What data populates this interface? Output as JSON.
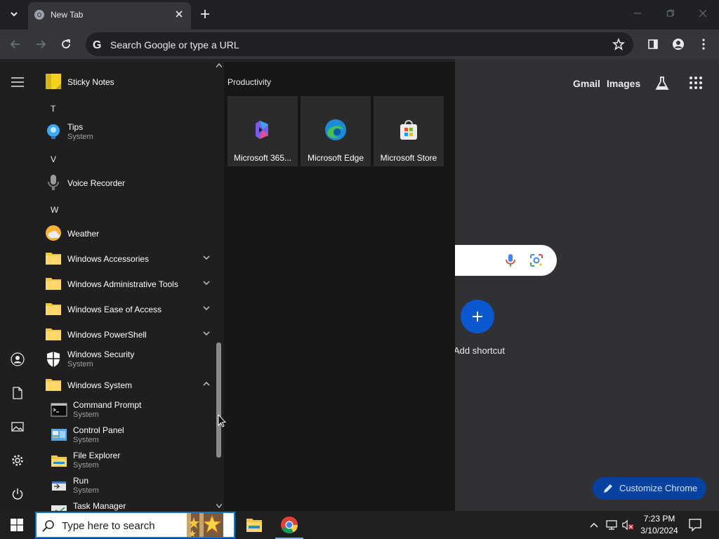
{
  "browser": {
    "tab_title": "New Tab",
    "omnibox_placeholder": "Search Google or type a URL"
  },
  "ntp": {
    "gmail": "Gmail",
    "images": "Images",
    "add_shortcut": "Add shortcut",
    "customize": "Customize Chrome"
  },
  "start_menu": {
    "letters": [
      "T",
      "V",
      "W"
    ],
    "apps": {
      "sticky_notes": "Sticky Notes",
      "tips": "Tips",
      "tips_sub": "System",
      "voice_recorder": "Voice Recorder",
      "weather": "Weather",
      "win_accessories": "Windows Accessories",
      "win_admin_tools": "Windows Administrative Tools",
      "win_ease": "Windows Ease of Access",
      "win_powershell": "Windows PowerShell",
      "win_security": "Windows Security",
      "win_security_sub": "System",
      "win_system": "Windows System",
      "cmd": "Command Prompt",
      "cmd_sub": "System",
      "control_panel": "Control Panel",
      "control_panel_sub": "System",
      "file_explorer": "File Explorer",
      "file_explorer_sub": "System",
      "run": "Run",
      "run_sub": "System",
      "task_manager": "Task Manager"
    },
    "group_title": "Productivity",
    "tiles": [
      "Microsoft 365...",
      "Microsoft Edge",
      "Microsoft Store"
    ]
  },
  "taskbar": {
    "search_placeholder": "Type here to search",
    "time": "7:23 PM",
    "date": "3/10/2024"
  },
  "colors": {
    "accent": "#0078d4",
    "chrome_dark": "#202124",
    "customize_bg": "#0842a0"
  }
}
